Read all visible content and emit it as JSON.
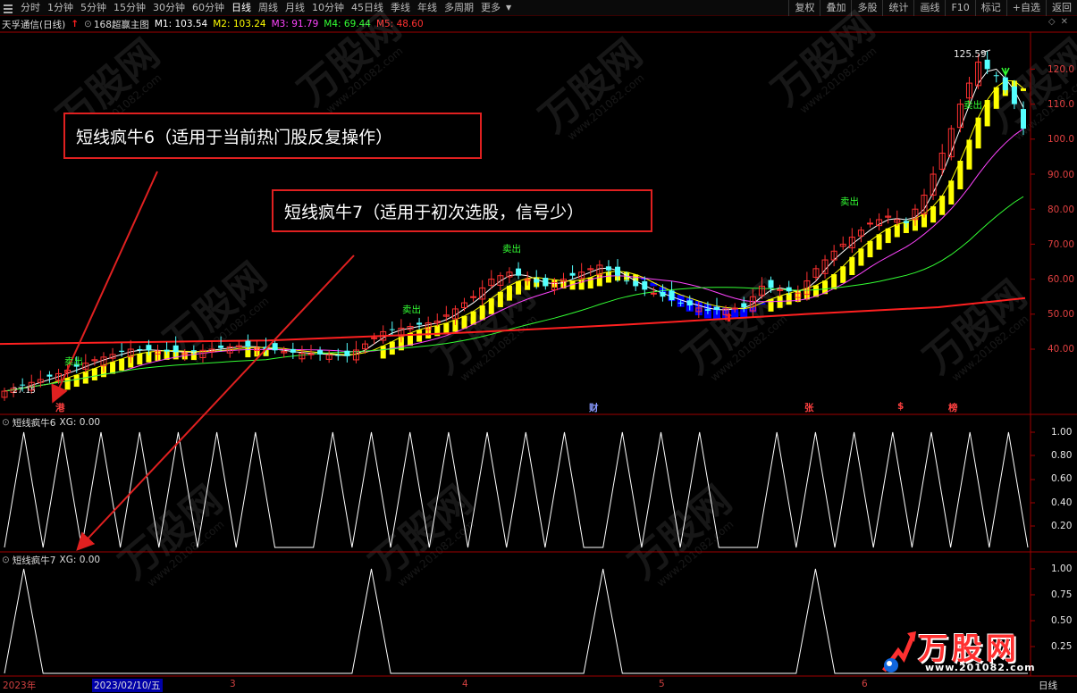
{
  "toolbar": {
    "periods": [
      "分时",
      "1分钟",
      "5分钟",
      "15分钟",
      "30分钟",
      "60分钟",
      "日线",
      "周线",
      "月线",
      "10分钟",
      "45日线",
      "季线",
      "年线",
      "多周期",
      "更多"
    ],
    "active_period": "日线",
    "buttons": [
      "复权",
      "叠加",
      "多股",
      "统计",
      "画线",
      "F10",
      "标记",
      "+自选",
      "返回"
    ]
  },
  "legend": {
    "stock": "天孚通信(日线)",
    "indicator": "168超赢主图",
    "ma": [
      {
        "label": "M1: 103.54",
        "color": "#ffffff"
      },
      {
        "label": "M2: 103.24",
        "color": "#ffff00"
      },
      {
        "label": "M3: 91.79",
        "color": "#ff44ff"
      },
      {
        "label": "M4: 69.44",
        "color": "#33ff33"
      },
      {
        "label": "M5: 48.60",
        "color": "#ff3030"
      }
    ]
  },
  "price_axis": [
    "120.0",
    "110.0",
    "100.0",
    "90.00",
    "80.00",
    "70.00",
    "60.00",
    "50.00",
    "40.00"
  ],
  "peak_label": "125.59",
  "low_label": "27.15",
  "signals": {
    "sell": "卖出"
  },
  "markers": [
    {
      "text": "港",
      "color": "#ff4040"
    },
    {
      "text": "财",
      "color": "#8899ff"
    },
    {
      "text": "张",
      "color": "#ff4040"
    },
    {
      "text": "$",
      "color": "#ff4040"
    },
    {
      "text": "榜",
      "color": "#ff4040"
    }
  ],
  "sub1": {
    "name": "短线疯牛6",
    "value": "XG: 0.00",
    "axis": [
      "1.00",
      "0.80",
      "0.60",
      "0.40",
      "0.20"
    ]
  },
  "sub2": {
    "name": "短线疯牛7",
    "value": "XG: 0.00",
    "axis": [
      "1.00",
      "0.75",
      "0.50",
      "0.25"
    ]
  },
  "x_axis": {
    "year": "2023年",
    "date": "2023/02/10/五",
    "months": [
      "3",
      "4",
      "5",
      "6"
    ],
    "period": "日线"
  },
  "callouts": {
    "c6": "短线疯牛6（适用于当前热门股反复操作）",
    "c7": "短线疯牛7（适用于初次选股，信号少）"
  },
  "watermark": {
    "title": "万股网",
    "url": "www.201082.com"
  },
  "colors": {
    "up": "#ff3030",
    "down": "#54ffff",
    "bull_band": "#ffff00",
    "bear_band": "#0000ff",
    "axis": "#a00000",
    "callout_border": "#e02020"
  },
  "chart_data": [
    {
      "type": "candlestick",
      "title": "天孚通信(日线)",
      "indicator": "168超赢主图",
      "ylim": [
        27,
        126
      ],
      "y_ticks": [
        40,
        50,
        60,
        70,
        80,
        90,
        100,
        110,
        120
      ],
      "x_labels": [
        "2023年",
        "2023/02/10/五",
        "3",
        "4",
        "5",
        "6"
      ],
      "annotations": {
        "high": 125.59,
        "low": 27.15
      },
      "series": [
        {
          "name": "M1",
          "value": 103.54
        },
        {
          "name": "M2",
          "value": 103.24
        },
        {
          "name": "M3",
          "value": 91.79
        },
        {
          "name": "M4",
          "value": 69.44
        },
        {
          "name": "M5",
          "value": 48.6
        }
      ]
    },
    {
      "type": "line",
      "title": "短线疯牛6",
      "ylim": [
        0,
        1
      ],
      "values": [
        0,
        1,
        0,
        1,
        0,
        1,
        0,
        1,
        0,
        1,
        0,
        1,
        0,
        1,
        0,
        0,
        0,
        1,
        0,
        1,
        0,
        1,
        0,
        1,
        0,
        1,
        0,
        1,
        0,
        1,
        0,
        0,
        1,
        0,
        1,
        0,
        1,
        0,
        0,
        0,
        1,
        0,
        1,
        0,
        1,
        0,
        1,
        0,
        1,
        0,
        1,
        0,
        1,
        0
      ]
    },
    {
      "type": "line",
      "title": "短线疯牛7",
      "ylim": [
        0,
        1
      ],
      "values": [
        0,
        1,
        0,
        0,
        0,
        0,
        0,
        0,
        0,
        0,
        0,
        0,
        0,
        0,
        0,
        0,
        0,
        0,
        0,
        1,
        0,
        0,
        0,
        0,
        0,
        0,
        0,
        0,
        0,
        0,
        0,
        1,
        0,
        0,
        0,
        0,
        0,
        0,
        0,
        0,
        0,
        0,
        1,
        0,
        0,
        0,
        0,
        0,
        0,
        0,
        0,
        0,
        0,
        0
      ]
    }
  ]
}
